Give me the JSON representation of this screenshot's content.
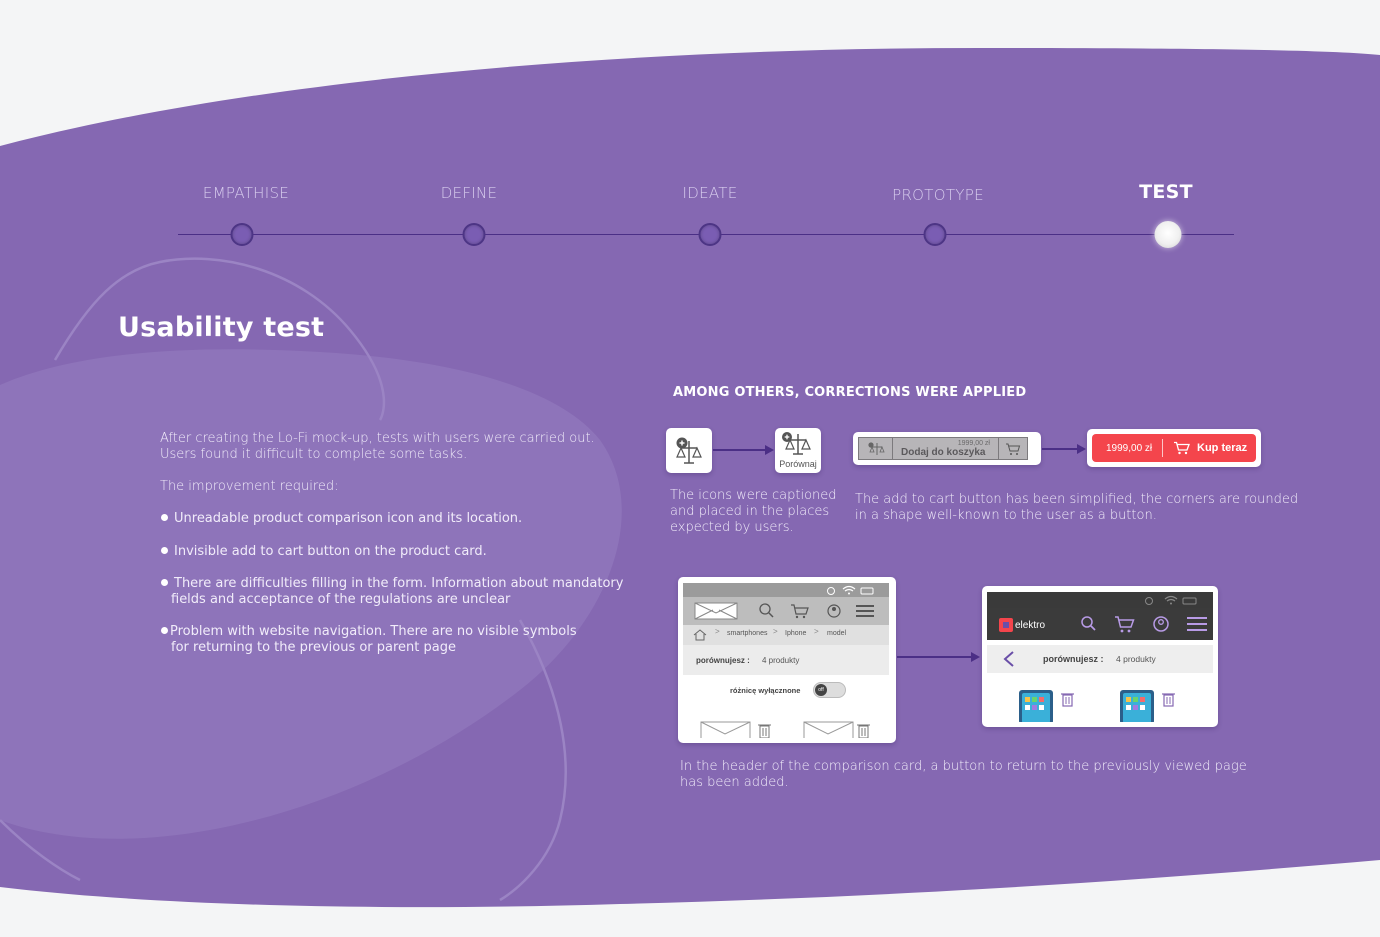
{
  "timeline": {
    "steps": [
      {
        "label": "EMPATHISE",
        "active": false
      },
      {
        "label": "DEFINE",
        "active": false
      },
      {
        "label": "IDEATE",
        "active": false
      },
      {
        "label": "PROTOTYPE",
        "active": false
      },
      {
        "label": "TEST",
        "active": true
      }
    ]
  },
  "section": {
    "title": "Usability test"
  },
  "intro": {
    "line1": "After creating the Lo-Fi mock-up, tests with users were carried out.",
    "line2": "Users found it difficult to complete some tasks.",
    "improvement_label": "The improvement required:",
    "bullets": [
      {
        "line1": "Unreadable product comparison icon and its location.",
        "line2": ""
      },
      {
        "line1": "Invisible add to cart button on the product card.",
        "line2": ""
      },
      {
        "line1": "There are difficulties filling in the form. Information about mandatory",
        "line2": "fields and acceptance of the regulations are unclear"
      },
      {
        "line1": "Problem with website navigation. There are no visible symbols",
        "line2": "for returning to the previous or parent page"
      }
    ]
  },
  "corrections": {
    "heading": "AMONG OTHERS, CORRECTIONS WERE APPLIED",
    "compare_icon_caption": "Porównaj",
    "caption1": {
      "line1": "The icons were captioned",
      "line2": "and placed in the places",
      "line3": "expected by users."
    },
    "lofi_cart": {
      "price": "1999,00 zł",
      "label": "Dodaj do koszyka"
    },
    "hifi_cart": {
      "price": "1999,00 zł",
      "label": "Kup teraz"
    },
    "caption2": {
      "line1": "The add to cart button has been simplified, the corners are rounded",
      "line2": "in a shape well-known to the user as a button."
    },
    "lofi_mock": {
      "breadcrumb": [
        "smartphones",
        "Iphone",
        "model"
      ],
      "compare_label": "porównujesz :",
      "compare_count": "4 produkty",
      "toggle_label": "różnicę wyłącznone",
      "toggle_state": "off"
    },
    "hifi_mock": {
      "brand": "elektro",
      "compare_label": "porównujesz :",
      "compare_count": "4 produkty"
    },
    "caption3": {
      "line1": "In the header of the comparison card, a button to return to the previously viewed page",
      "line2": "has been added."
    }
  },
  "colors": {
    "purple": "#8568b2",
    "dark_purple": "#4b2f86",
    "red": "#f4454c",
    "page_bg": "#f4f5f6"
  }
}
